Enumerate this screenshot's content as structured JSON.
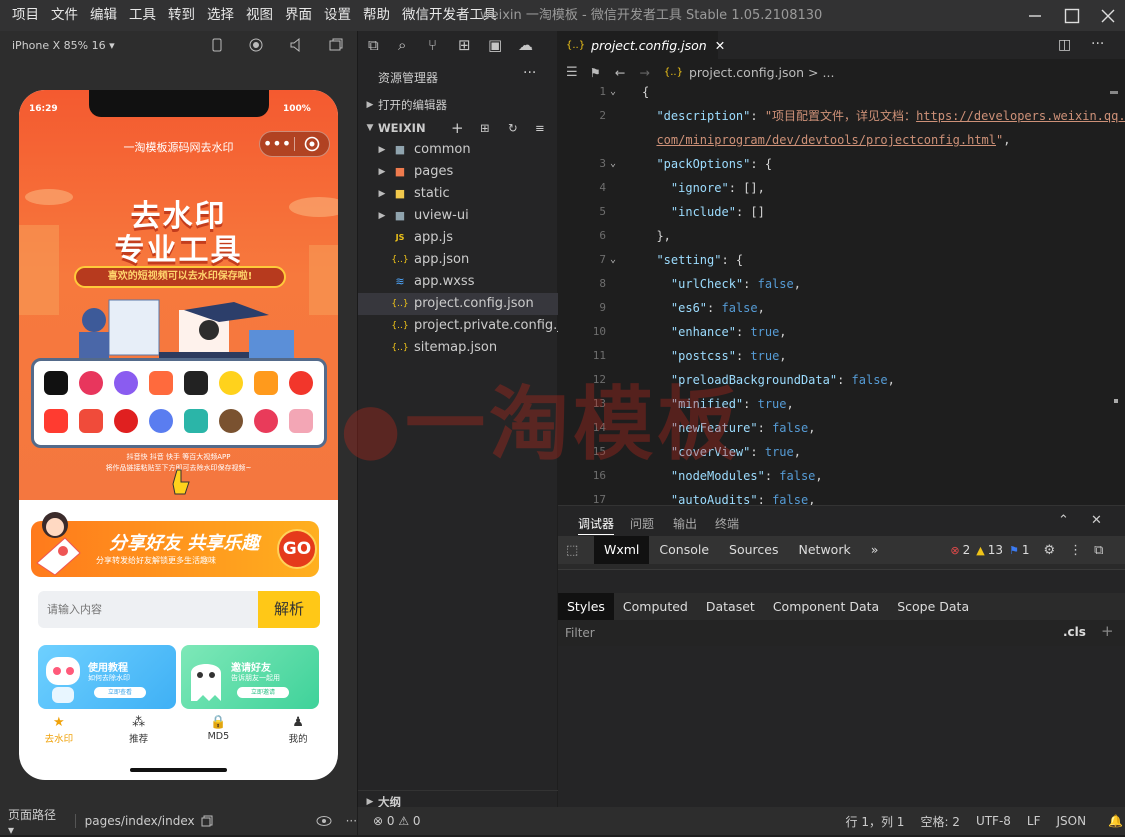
{
  "menubar": {
    "items": [
      "项目",
      "文件",
      "编辑",
      "工具",
      "转到",
      "选择",
      "视图",
      "界面",
      "设置",
      "帮助",
      "微信开发者工具"
    ],
    "window_title": "weixin 一淘模板 - 微信开发者工具 Stable 1.05.2108130"
  },
  "simulator": {
    "device": "iPhone X 85% 16 ▾",
    "status_time": "16:29",
    "status_battery": "100%",
    "mp_title": "一淘模板源码网去水印",
    "hero_title_1": "去水印",
    "hero_title_2": "专业工具",
    "hero_banner": "喜欢的短视频可以去水印保存啦!",
    "hero_note_1": "抖音快 抖音 快手 等百大视频APP",
    "hero_note_2": "将作品链接粘贴至下方即可去除水印保存视频~",
    "share_title": "分享好友 共享乐趣",
    "share_sub": "分享转发给好友解锁更多生活趣味",
    "go_label": "GO",
    "search_placeholder": "请输入内容",
    "parse_button": "解析",
    "card1_title": "使用教程",
    "card1_sub": "如何去除水印",
    "card1_btn": "立即查看",
    "card2_title": "邀请好友",
    "card2_sub": "告诉朋友一起用",
    "card2_btn": "立即邀请",
    "tabs": [
      {
        "label": "去水印",
        "icon": "★"
      },
      {
        "label": "推荐",
        "icon": "⁂"
      },
      {
        "label": "MD5",
        "icon": "🔒"
      },
      {
        "label": "我的",
        "icon": "♟"
      }
    ],
    "footer_path_label": "页面路径 ▾",
    "footer_path": "pages/index/index"
  },
  "explorer": {
    "header": "资源管理器",
    "open_editors": "打开的编辑器",
    "workspace": "WEIXIN",
    "outline": "大纲",
    "tree": [
      {
        "name": "common",
        "type": "folder",
        "icon_color": "#90a4ae"
      },
      {
        "name": "pages",
        "type": "folder",
        "icon_color": "#ef7b4e"
      },
      {
        "name": "static",
        "type": "folder",
        "icon_color": "#f2c94c"
      },
      {
        "name": "uview-ui",
        "type": "folder",
        "icon_color": "#90a4ae"
      },
      {
        "name": "app.js",
        "type": "js",
        "icon": "JS",
        "icon_color": "#f0c419"
      },
      {
        "name": "app.json",
        "type": "json",
        "icon": "{..}",
        "icon_color": "#f0c419"
      },
      {
        "name": "app.wxss",
        "type": "wxss",
        "icon": "≋",
        "icon_color": "#4fa8ff"
      },
      {
        "name": "project.config.json",
        "type": "json",
        "icon": "{..}",
        "icon_color": "#f0c419",
        "selected": true
      },
      {
        "name": "project.private.config.js...",
        "type": "json",
        "icon": "{..}",
        "icon_color": "#f0c419"
      },
      {
        "name": "sitemap.json",
        "type": "json",
        "icon": "{..}",
        "icon_color": "#f0c419"
      }
    ]
  },
  "editor": {
    "tab_label": "project.config.json",
    "breadcrumb": "project.config.json > ...",
    "lines": [
      {
        "n": "1",
        "fold": "⌄",
        "html": "<span class='p'>{</span>"
      },
      {
        "n": "2",
        "fold": "",
        "html": "  <span class='k'>\"description\"</span><span class='p'>: </span><span class='s'>\"项目配置文件，详见文档：</span><span class='u'>https://developers.weixin.qq.</span>"
      },
      {
        "n": "",
        "fold": "",
        "html": "  <span class='u'>com/miniprogram/dev/devtools/projectconfig.html</span><span class='s'>\"</span><span class='p'>,</span>"
      },
      {
        "n": "3",
        "fold": "⌄",
        "html": "  <span class='k'>\"packOptions\"</span><span class='p'>: {</span>"
      },
      {
        "n": "4",
        "fold": "",
        "html": "    <span class='k'>\"ignore\"</span><span class='p'>: [],</span>"
      },
      {
        "n": "5",
        "fold": "",
        "html": "    <span class='k'>\"include\"</span><span class='p'>: []</span>"
      },
      {
        "n": "6",
        "fold": "",
        "html": "  <span class='p'>},</span>"
      },
      {
        "n": "7",
        "fold": "⌄",
        "html": "  <span class='k'>\"setting\"</span><span class='p'>: {</span>"
      },
      {
        "n": "8",
        "fold": "",
        "html": "    <span class='k'>\"urlCheck\"</span><span class='p'>: </span><span class='b'>false</span><span class='p'>,</span>"
      },
      {
        "n": "9",
        "fold": "",
        "html": "    <span class='k'>\"es6\"</span><span class='p'>: </span><span class='b'>false</span><span class='p'>,</span>"
      },
      {
        "n": "10",
        "fold": "",
        "html": "    <span class='k'>\"enhance\"</span><span class='p'>: </span><span class='b'>true</span><span class='p'>,</span>"
      },
      {
        "n": "11",
        "fold": "",
        "html": "    <span class='k'>\"postcss\"</span><span class='p'>: </span><span class='b'>true</span><span class='p'>,</span>"
      },
      {
        "n": "12",
        "fold": "",
        "html": "    <span class='k'>\"preloadBackgroundData\"</span><span class='p'>: </span><span class='b'>false</span><span class='p'>,</span>"
      },
      {
        "n": "13",
        "fold": "",
        "html": "    <span class='k'>\"minified\"</span><span class='p'>: </span><span class='b'>true</span><span class='p'>,</span>"
      },
      {
        "n": "14",
        "fold": "",
        "html": "    <span class='k'>\"newFeature\"</span><span class='p'>: </span><span class='b'>false</span><span class='p'>,</span>"
      },
      {
        "n": "15",
        "fold": "",
        "html": "    <span class='k'>\"coverView\"</span><span class='p'>: </span><span class='b'>true</span><span class='p'>,</span>"
      },
      {
        "n": "16",
        "fold": "",
        "html": "    <span class='k'>\"nodeModules\"</span><span class='p'>: </span><span class='b'>false</span><span class='p'>,</span>"
      },
      {
        "n": "17",
        "fold": "",
        "html": "    <span class='k'>\"autoAudits\"</span><span class='p'>: </span><span class='b'>false</span><span class='p'>,</span>"
      }
    ],
    "watermark": "一淘模板"
  },
  "debugger": {
    "tabs": [
      "调试器",
      "问题",
      "输出",
      "终端"
    ],
    "devtools_tabs": [
      "Wxml",
      "Console",
      "Sources",
      "Network"
    ],
    "errors": "2",
    "warnings": "13",
    "infos": "1",
    "styles_tabs": [
      "Styles",
      "Computed",
      "Dataset",
      "Component Data",
      "Scope Data"
    ],
    "filter_placeholder": "Filter",
    "cls": ".cls",
    "plus": "+"
  },
  "statusbar": {
    "problems": "⊗ 0 ⚠ 0",
    "position": "行 1，列 1",
    "spaces": "空格: 2",
    "encoding": "UTF-8",
    "eol": "LF",
    "language": "JSON"
  }
}
